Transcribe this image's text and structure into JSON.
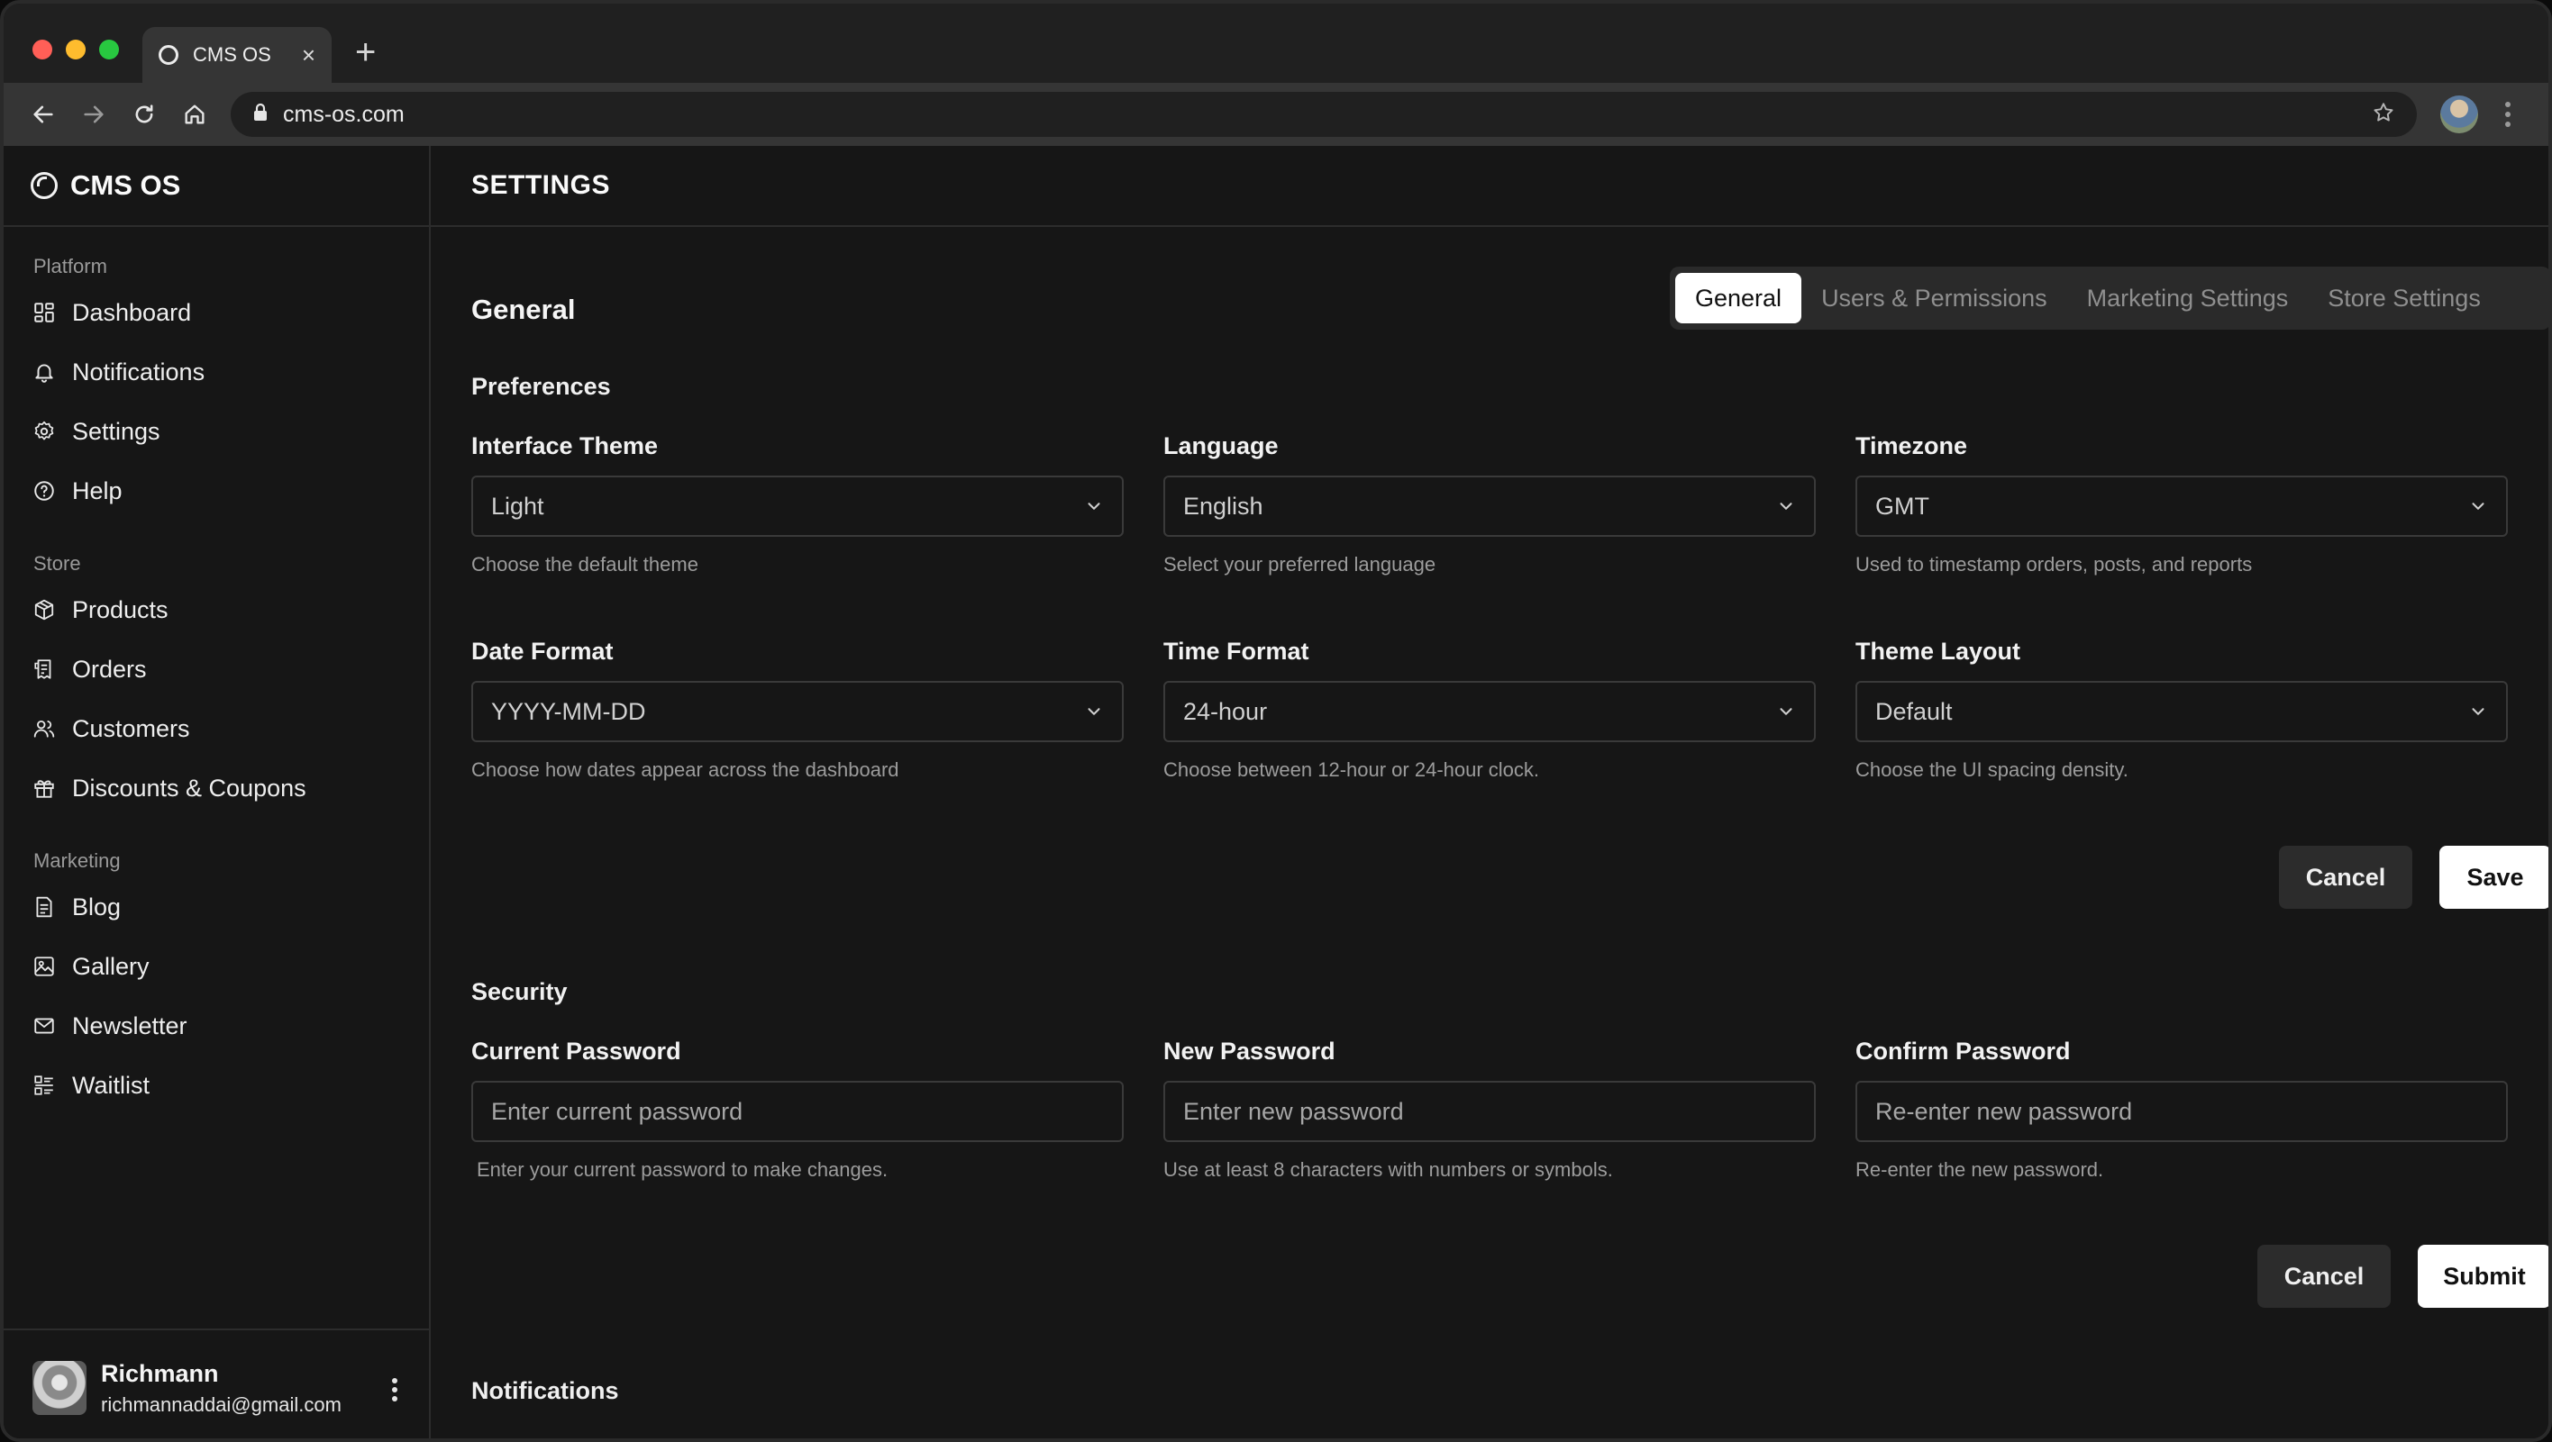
{
  "browser": {
    "tab_title": "CMS OS",
    "url": "cms-os.com"
  },
  "sidebar": {
    "brand": "CMS OS",
    "sections": [
      {
        "label": "Platform",
        "items": [
          {
            "label": "Dashboard",
            "icon": "dashboard-icon"
          },
          {
            "label": "Notifications",
            "icon": "bell-icon"
          },
          {
            "label": "Settings",
            "icon": "gear-icon"
          },
          {
            "label": "Help",
            "icon": "help-icon"
          }
        ]
      },
      {
        "label": "Store",
        "items": [
          {
            "label": "Products",
            "icon": "box-icon"
          },
          {
            "label": "Orders",
            "icon": "receipt-icon"
          },
          {
            "label": "Customers",
            "icon": "users-icon"
          },
          {
            "label": "Discounts & Coupons",
            "icon": "gift-icon"
          }
        ]
      },
      {
        "label": "Marketing",
        "items": [
          {
            "label": "Blog",
            "icon": "document-icon"
          },
          {
            "label": "Gallery",
            "icon": "image-icon"
          },
          {
            "label": "Newsletter",
            "icon": "mail-icon"
          },
          {
            "label": "Waitlist",
            "icon": "list-icon"
          }
        ]
      }
    ],
    "user": {
      "name": "Richmann",
      "email": "richmannaddai@gmail.com"
    }
  },
  "header": {
    "title": "SETTINGS"
  },
  "main": {
    "section_title": "General",
    "tabs": [
      "General",
      "Users & Permissions",
      "Marketing Settings",
      "Store Settings"
    ],
    "active_tab": "General",
    "preferences": {
      "title": "Preferences",
      "fields": [
        {
          "label": "Interface Theme",
          "value": "Light",
          "help": "Choose the default theme"
        },
        {
          "label": "Language",
          "value": "English",
          "help": "Select your preferred language"
        },
        {
          "label": "Timezone",
          "value": "GMT",
          "help": "Used to timestamp orders, posts, and reports"
        },
        {
          "label": "Date Format",
          "value": "YYYY-MM-DD",
          "help": "Choose how dates appear across the dashboard"
        },
        {
          "label": "Time Format",
          "value": "24-hour",
          "help": "Choose between 12-hour or 24-hour clock."
        },
        {
          "label": "Theme Layout",
          "value": "Default",
          "help": "Choose the UI spacing density."
        }
      ],
      "cancel_label": "Cancel",
      "save_label": "Save"
    },
    "security": {
      "title": "Security",
      "fields": [
        {
          "label": "Current Password",
          "placeholder": "Enter current password",
          "help": "Enter your current password to make changes."
        },
        {
          "label": "New Password",
          "placeholder": "Enter new password",
          "help": "Use at least 8 characters with numbers or symbols."
        },
        {
          "label": "Confirm Password",
          "placeholder": "Re-enter new password",
          "help": "Re-enter the new password."
        }
      ],
      "cancel_label": "Cancel",
      "submit_label": "Submit"
    },
    "notifications": {
      "title": "Notifications"
    }
  }
}
